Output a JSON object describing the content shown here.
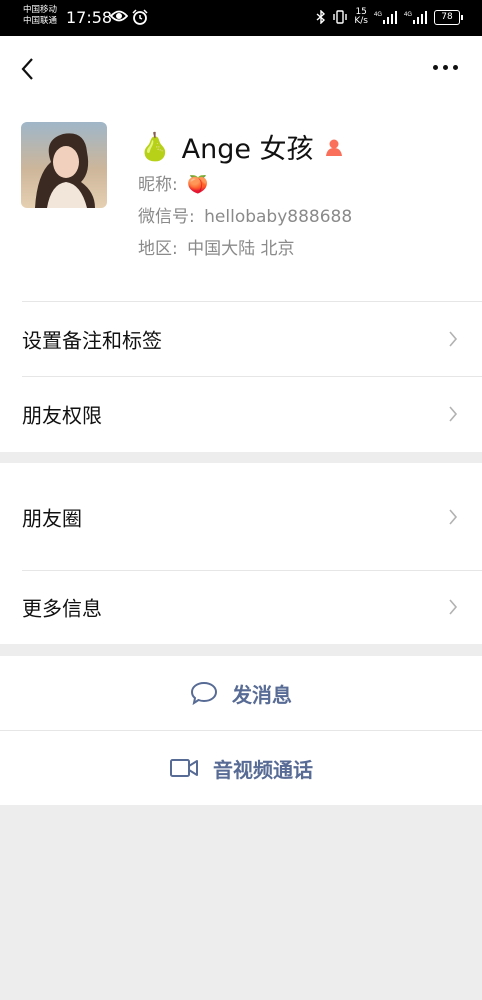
{
  "status_bar": {
    "carrier_1": "中国移动",
    "carrier_2": "中国联通",
    "time": "17:58",
    "speed_value": "15",
    "speed_unit": "K/s",
    "net_1": "4G",
    "net_2": "4G",
    "battery": "78",
    "icons": [
      "eye-icon",
      "alarm-icon",
      "bluetooth-icon",
      "vibrate-icon",
      "signal-icon",
      "signal-icon",
      "battery-icon"
    ]
  },
  "header": {
    "back_icon": "chevron-left-icon",
    "more_icon": "more-icon"
  },
  "profile": {
    "name_emoji": "🍐",
    "name": "Ange 女孩",
    "gender_icon": "female-icon",
    "gender_color": "#fa6f5a",
    "nickname_label": "昵称:",
    "nickname_value": "🍑",
    "wechat_id_label": "微信号:",
    "wechat_id_value": "hellobaby888688",
    "region_label": "地区:",
    "region_value": "中国大陆  北京"
  },
  "menu": {
    "section_1": [
      {
        "label": "设置备注和标签"
      },
      {
        "label": "朋友权限"
      }
    ],
    "section_2": [
      {
        "label": "朋友圈"
      },
      {
        "label": "更多信息"
      }
    ]
  },
  "actions": {
    "message_label": "发消息",
    "video_call_label": "音视频通话",
    "accent_color": "#576b95"
  }
}
